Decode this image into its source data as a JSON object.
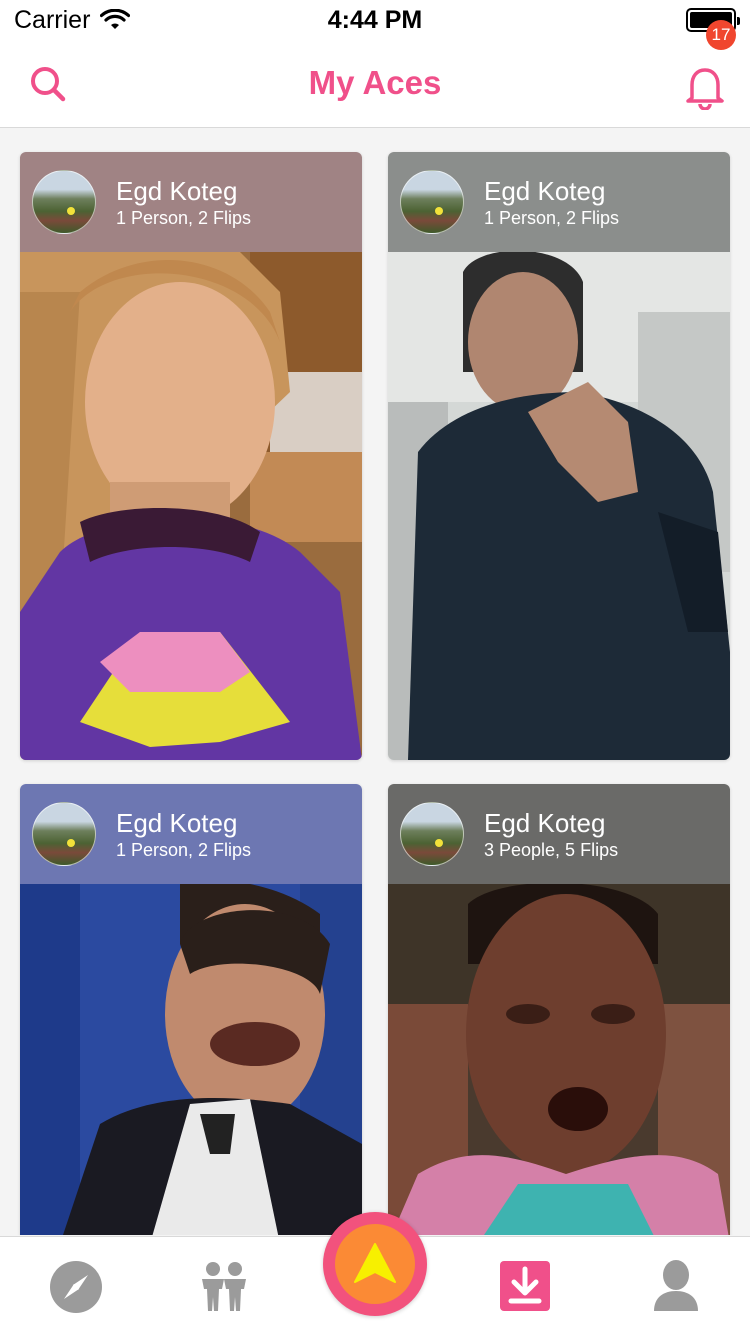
{
  "status_bar": {
    "carrier": "Carrier",
    "time": "4:44 PM"
  },
  "header": {
    "title": "My Aces",
    "notification_count": "17"
  },
  "cards": [
    {
      "name": "Egd Koteg",
      "meta": "1 Person, 2 Flips",
      "header_color": "#a08384"
    },
    {
      "name": "Egd Koteg",
      "meta": "1 Person, 2 Flips",
      "header_color": "#8b8e8c"
    },
    {
      "name": "Egd Koteg",
      "meta": "1 Person, 2 Flips",
      "header_color": "#6d77b2"
    },
    {
      "name": "Egd Koteg",
      "meta": "3 People, 5 Flips",
      "header_color": "#6a6a68"
    }
  ],
  "tab_bar": {
    "tabs": [
      "explore-icon",
      "people-icon",
      "ace-icon",
      "download-icon",
      "profile-icon"
    ],
    "active": "download-icon"
  },
  "colors": {
    "accent": "#f0508a",
    "badge": "#f0462e",
    "center_outer": "#f2527d",
    "center_inner": "#fb8a35",
    "center_arrow": "#f7f000",
    "tab_inactive": "#9b9b9b"
  }
}
